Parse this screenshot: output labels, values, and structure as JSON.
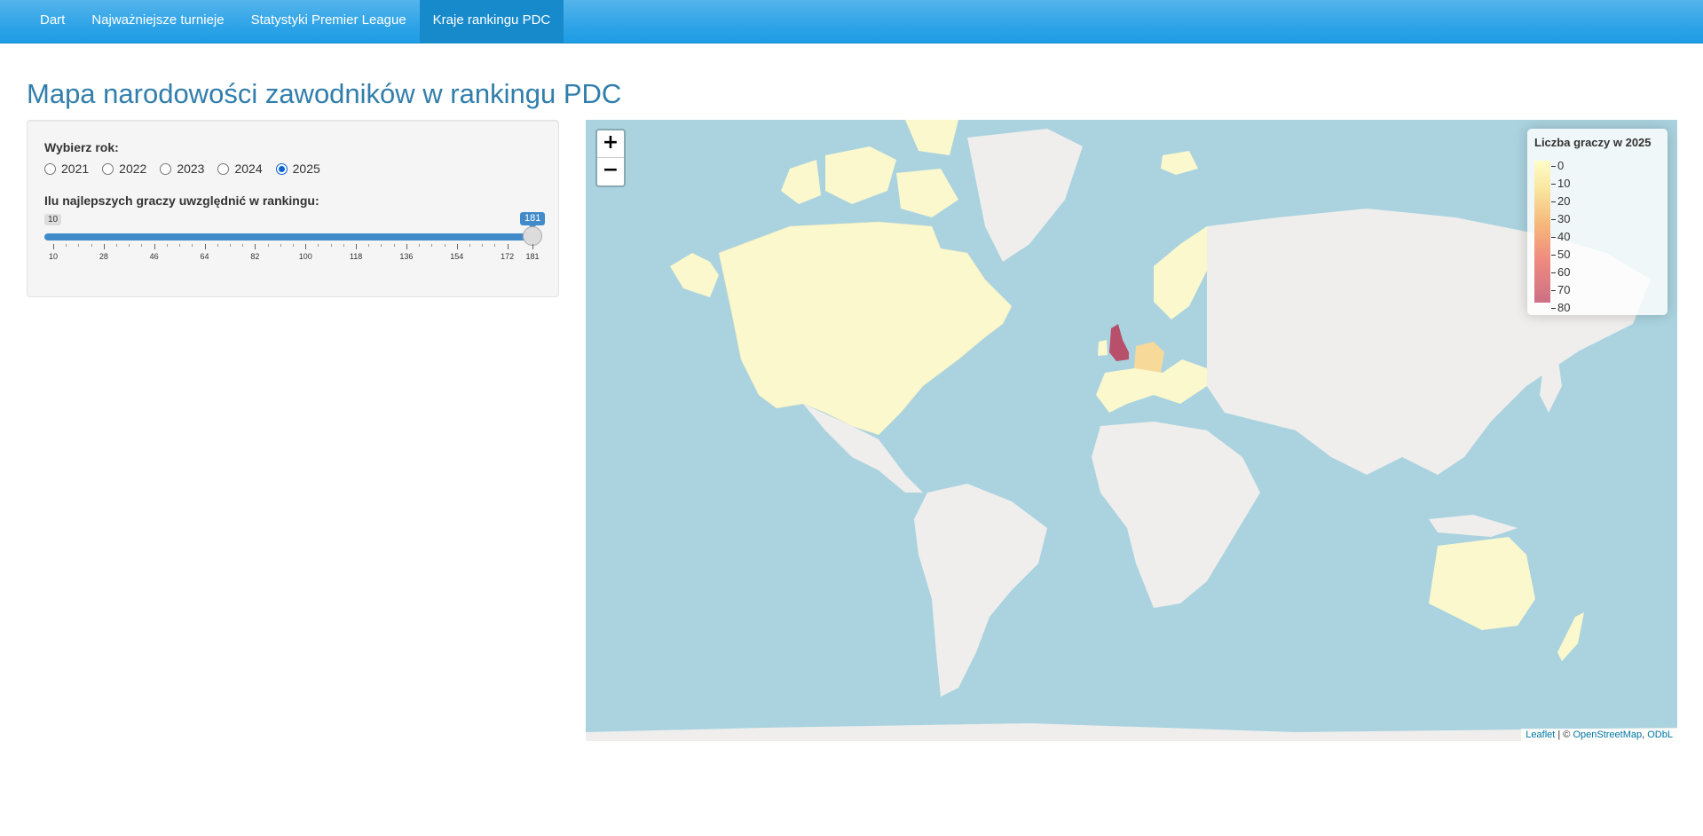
{
  "navbar": {
    "items": [
      {
        "label": "Dart",
        "active": false
      },
      {
        "label": "Najważniejsze turnieje",
        "active": false
      },
      {
        "label": "Statystyki Premier League",
        "active": false
      },
      {
        "label": "Kraje rankingu PDC",
        "active": true
      }
    ]
  },
  "page": {
    "title": "Mapa narodowości zawodników w rankingu PDC"
  },
  "sidebar": {
    "year_label": "Wybierz rok:",
    "years": [
      "2021",
      "2022",
      "2023",
      "2024",
      "2025"
    ],
    "selected_year": "2025",
    "top_label": "Ilu najlepszych graczy uwzględnić w rankingu:",
    "slider": {
      "min": "10",
      "max": "181",
      "value": "181",
      "tick_labels": [
        "10",
        "28",
        "46",
        "64",
        "82",
        "100",
        "118",
        "136",
        "154",
        "172",
        "181"
      ]
    }
  },
  "map": {
    "zoom_in": "+",
    "zoom_out": "−",
    "legend": {
      "title": "Liczba graczy w 2025",
      "values": [
        "0",
        "10",
        "20",
        "30",
        "40",
        "50",
        "60",
        "70",
        "80"
      ]
    },
    "attribution": {
      "leaflet": "Leaflet",
      "sep": "|",
      "copy": "©",
      "osm": "OpenStreetMap",
      "comma": ",",
      "odbl": "ODbL"
    },
    "colors": {
      "sea": "#aad3df",
      "land": "#efeeec",
      "low": "#fbf8cd",
      "mid": "#f7d99a",
      "high": "#b8506c"
    }
  }
}
